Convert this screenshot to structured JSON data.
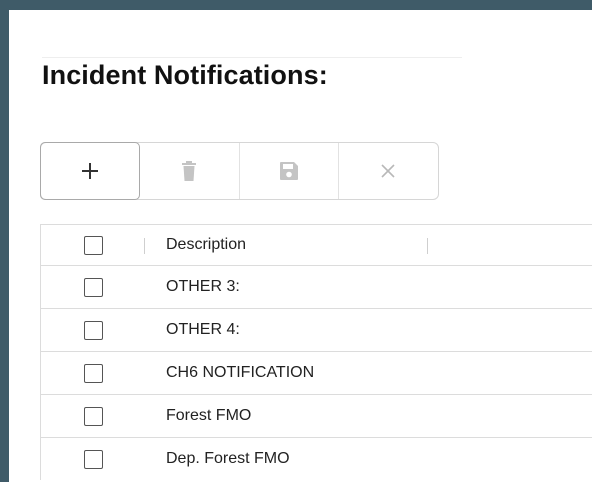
{
  "panel": {
    "title": "Incident Notifications:"
  },
  "toolbar": {
    "buttons": [
      {
        "name": "add",
        "icon": "plus-icon",
        "state": "enabled"
      },
      {
        "name": "delete",
        "icon": "trash-icon",
        "state": "disabled"
      },
      {
        "name": "save",
        "icon": "save-icon",
        "state": "disabled"
      },
      {
        "name": "cancel",
        "icon": "close-icon",
        "state": "disabled"
      }
    ]
  },
  "grid": {
    "columns": [
      "Description"
    ],
    "rows": [
      {
        "description": "OTHER 3:",
        "checked": false
      },
      {
        "description": "OTHER 4:",
        "checked": false
      },
      {
        "description": "CH6 NOTIFICATION",
        "checked": false
      },
      {
        "description": "Forest FMO",
        "checked": false
      },
      {
        "description": "Dep. Forest FMO",
        "checked": false
      }
    ]
  },
  "colors": {
    "frame": "#3f5b68",
    "panel": "#ffffff",
    "icon_enabled": "#333333",
    "icon_disabled": "#c4c4c4",
    "border": "#dcdcdc"
  }
}
